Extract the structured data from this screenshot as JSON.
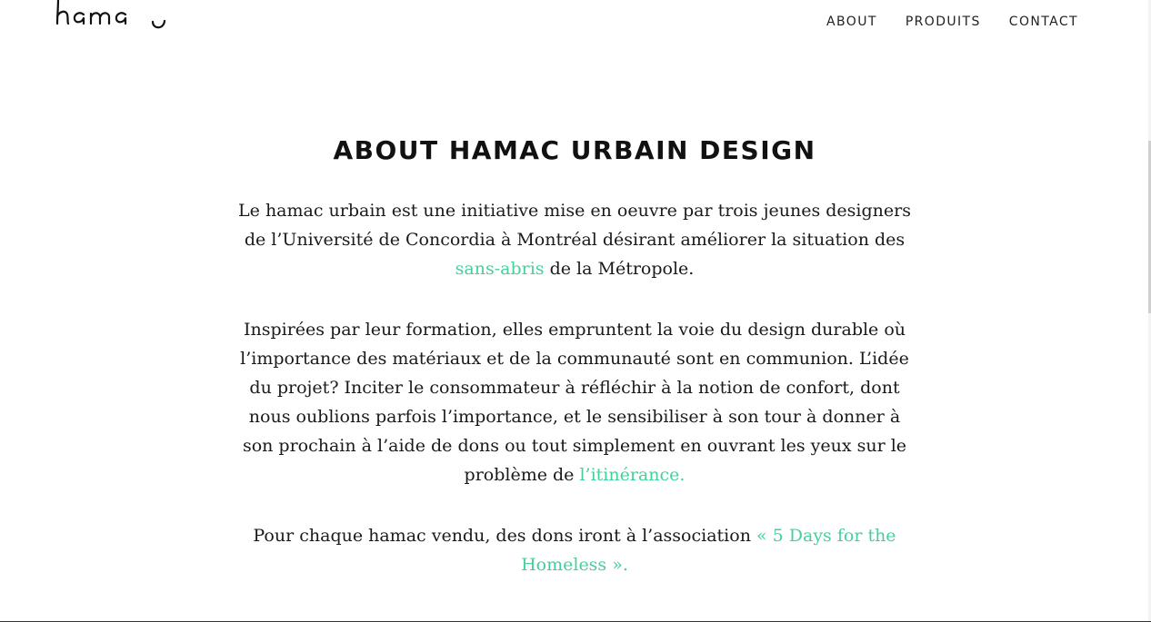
{
  "header": {
    "logo_text": "hamac",
    "logo_icon": "handwritten-logo",
    "nav": [
      {
        "label": "ABOUT"
      },
      {
        "label": "PRODUITS"
      },
      {
        "label": "CONTACT"
      }
    ]
  },
  "main": {
    "title": "ABOUT HAMAC URBAIN DESIGN",
    "p1": {
      "text_before": "Le hamac urbain est une initiative mise en oeuvre par trois jeunes designers de l’Université de Concordia à Montréal désirant améliorer la situation des ",
      "link": "sans-abris",
      "text_after": " de la Métropole."
    },
    "p2": {
      "text_before": "Inspirées par leur formation, elles empruntent la voie du design durable où l’importance des matériaux et de la communauté sont en communion. L’idée du projet? Inciter le consommateur à réfléchir à la notion de confort, dont nous oublions parfois l’importance, et le sensibiliser à son tour à donner à son prochain à l’aide de dons ou tout simplement en ouvrant les yeux sur le problème de ",
      "link": "l’itinérance."
    },
    "p3": {
      "text_before": "Pour chaque hamac vendu, des dons iront à l’association ",
      "link": "« 5 Days for the Homeless »."
    }
  },
  "colors": {
    "link": "#45d09a",
    "text": "#1a1a1a",
    "background": "#ffffff"
  }
}
